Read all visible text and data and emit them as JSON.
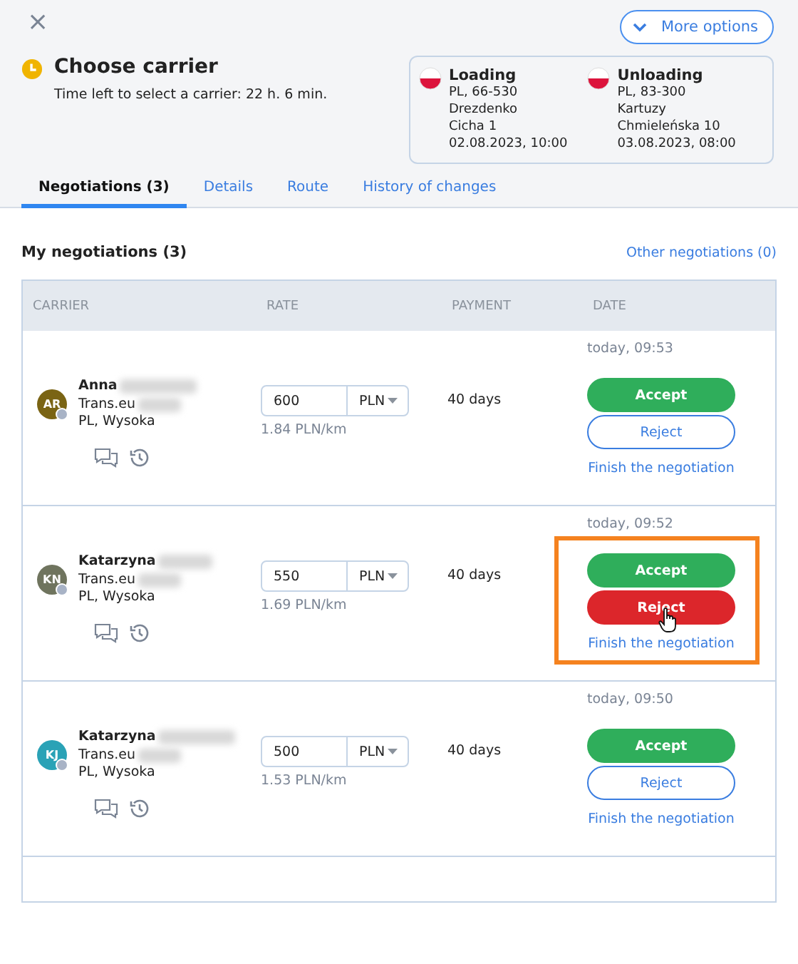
{
  "close_icon": "×",
  "more_options": "More options",
  "header": {
    "title": "Choose carrier",
    "subtitle": "Time left to select a carrier: 22 h. 6 min."
  },
  "route": [
    {
      "label": "Loading",
      "lines": [
        "PL, 66-530",
        "Drezdenko",
        "Cicha 1",
        "02.08.2023, 10:00"
      ]
    },
    {
      "label": "Unloading",
      "lines": [
        "PL, 83-300",
        "Kartuzy",
        "Chmieleńska 10",
        "03.08.2023, 08:00"
      ]
    }
  ],
  "tabs": [
    {
      "label": "Negotiations (3)",
      "selected": true
    },
    {
      "label": "Details",
      "selected": false
    },
    {
      "label": "Route",
      "selected": false
    },
    {
      "label": "History of changes",
      "selected": false
    }
  ],
  "section": {
    "title": "My negotiations (3)",
    "other_link": "Other negotiations (0)"
  },
  "table": {
    "columns": [
      "CARRIER",
      "RATE",
      "PAYMENT",
      "DATE"
    ],
    "rows": [
      {
        "initials": "AR",
        "color": "#7a6414",
        "name": "Anna",
        "company": "Trans.eu",
        "location": "PL, Wysoka",
        "rate": "600",
        "currency": "PLN",
        "per_km": "1.84 PLN/km",
        "payment": "40 days",
        "date": "today, 09:53",
        "accept": "Accept",
        "reject": "Reject",
        "reject_hovered": false,
        "highlighted": false,
        "finish": "Finish the negotiation"
      },
      {
        "initials": "KN",
        "color": "#6f745e",
        "name": "Katarzyna",
        "company": "Trans.eu",
        "location": "PL, Wysoka",
        "rate": "550",
        "currency": "PLN",
        "per_km": "1.69 PLN/km",
        "payment": "40 days",
        "date": "today, 09:52",
        "accept": "Accept",
        "reject": "Reject",
        "reject_hovered": true,
        "highlighted": true,
        "finish": "Finish the negotiation"
      },
      {
        "initials": "KJ",
        "color": "#2aa2b6",
        "name": "Katarzyna",
        "company": "Trans.eu",
        "location": "PL, Wysoka",
        "rate": "500",
        "currency": "PLN",
        "per_km": "1.53 PLN/km",
        "payment": "40 days",
        "date": "today, 09:50",
        "accept": "Accept",
        "reject": "Reject",
        "reject_hovered": false,
        "highlighted": false,
        "finish": "Finish the negotiation"
      }
    ]
  }
}
